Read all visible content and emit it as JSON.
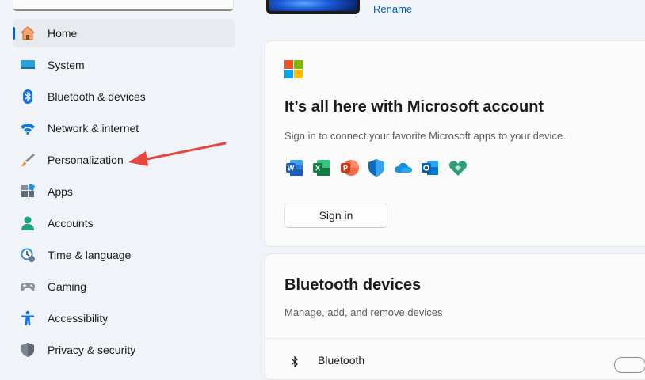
{
  "sidebar": {
    "items": [
      {
        "label": "Home",
        "icon": "home-icon",
        "active": true
      },
      {
        "label": "System",
        "icon": "system-icon"
      },
      {
        "label": "Bluetooth & devices",
        "icon": "bluetooth-icon"
      },
      {
        "label": "Network & internet",
        "icon": "wifi-icon"
      },
      {
        "label": "Personalization",
        "icon": "paintbrush-icon"
      },
      {
        "label": "Apps",
        "icon": "apps-icon"
      },
      {
        "label": "Accounts",
        "icon": "person-icon"
      },
      {
        "label": "Time & language",
        "icon": "clock-globe-icon"
      },
      {
        "label": "Gaming",
        "icon": "gamepad-icon"
      },
      {
        "label": "Accessibility",
        "icon": "accessibility-icon"
      },
      {
        "label": "Privacy & security",
        "icon": "shield-icon"
      }
    ]
  },
  "device": {
    "rename_label": "Rename"
  },
  "microsoft_card": {
    "title": "It’s all here with Microsoft account",
    "subtitle": "Sign in to connect your favorite Microsoft apps to your device.",
    "apps": [
      "word-icon",
      "excel-icon",
      "powerpoint-icon",
      "defender-icon",
      "onedrive-icon",
      "outlook-icon",
      "family-safety-icon"
    ],
    "signin_label": "Sign in"
  },
  "bluetooth_card": {
    "title": "Bluetooth devices",
    "subtitle": "Manage, add, and remove devices",
    "row_label": "Bluetooth"
  },
  "colors": {
    "accent": "#005fb8",
    "annotation_arrow": "#e8453c"
  }
}
